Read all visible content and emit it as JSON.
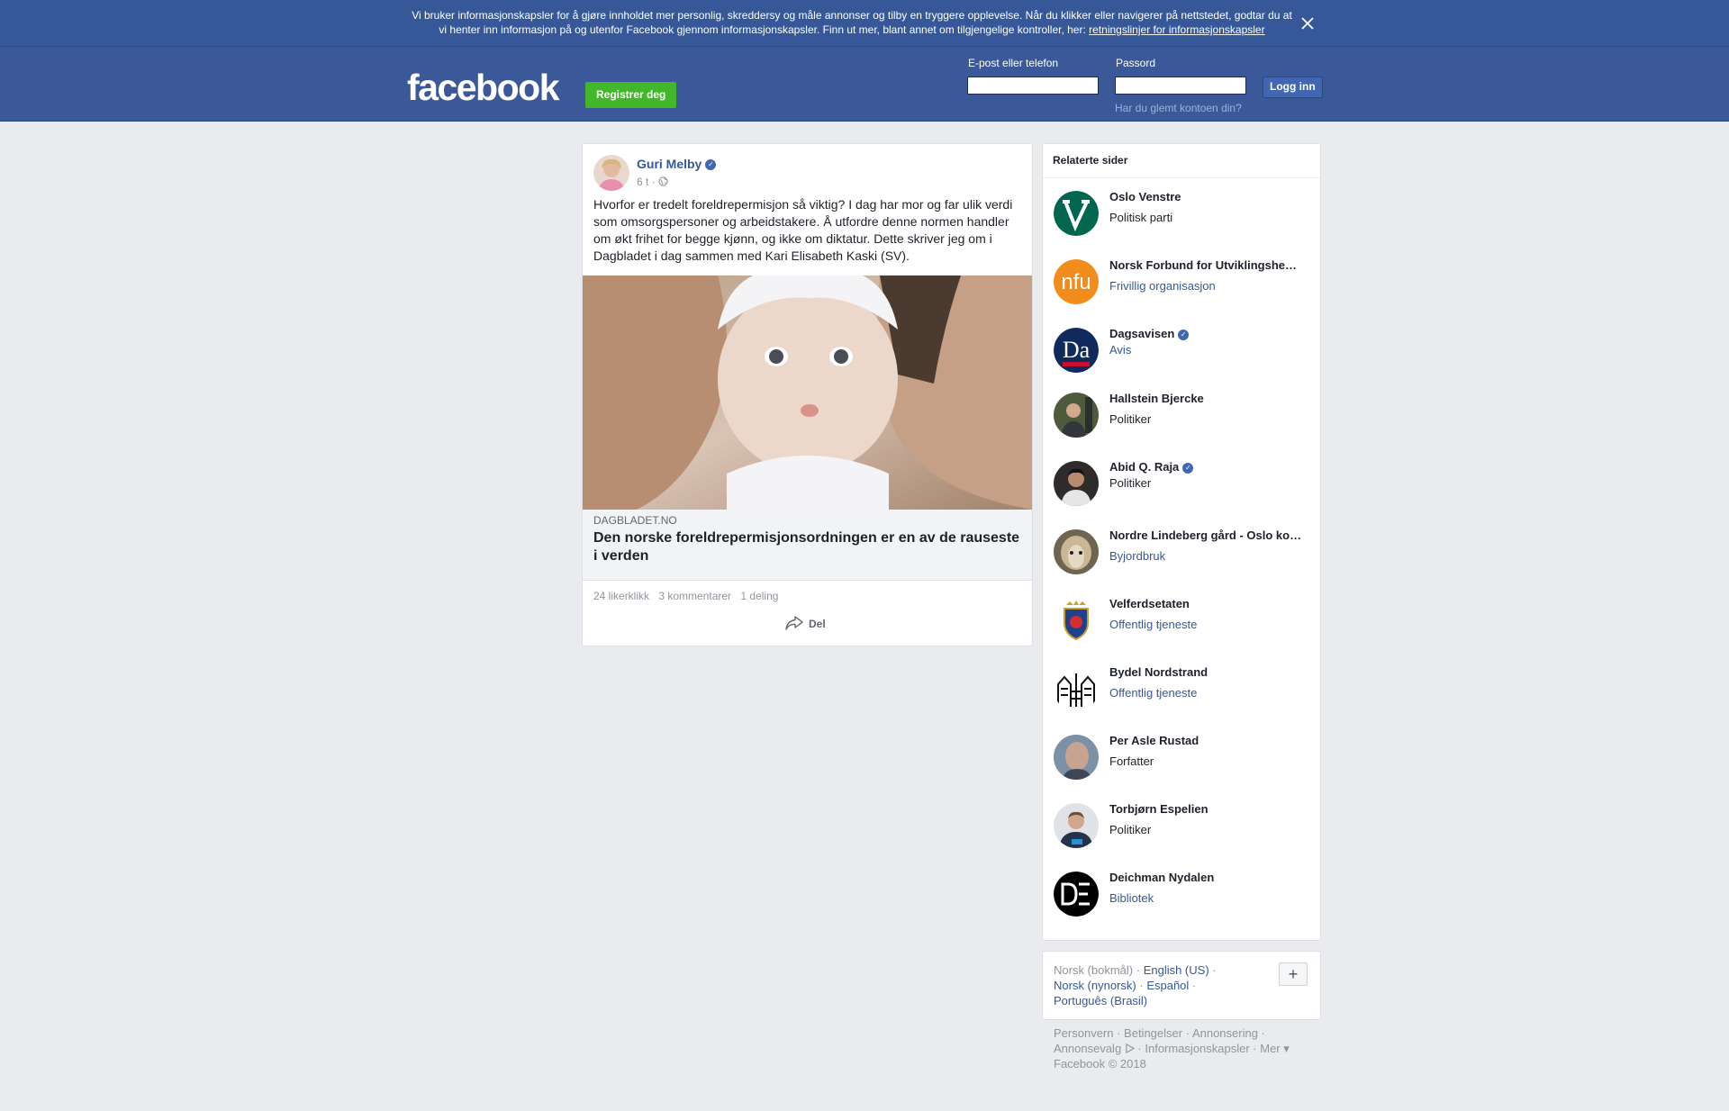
{
  "cookie_banner": {
    "text": "Vi bruker informasjonskapsler for å gjøre innholdet mer personlig, skreddersy og måle annonser og tilby en tryggere opplevelse. Når du klikker eller navigerer på nettstedet, godtar du at vi henter inn informasjon på og utenfor Facebook gjennom informasjonskapsler. Finn ut mer, blant annet om tilgjengelige kontroller, her: ",
    "link": "retningslinjer for informasjonskapsler",
    "close_icon": "close-icon"
  },
  "header": {
    "logo": "facebook",
    "register": "Registrer deg",
    "email_label": "E-post eller telefon",
    "password_label": "Passord",
    "login": "Logg inn",
    "forgot": "Har du glemt kontoen din?"
  },
  "post": {
    "author": "Guri Melby",
    "time": "6 t",
    "text": "Hvorfor er tredelt foreldrepermisjon så viktig? I dag har mor og far ulik verdi som omsorgspersoner og arbeidstakere. Å utfordre denne normen handler om økt frihet for begge kjønn, og ikke om diktatur. Dette skriver jeg om i Dagbladet i dag sammen med Kari Elisabeth Kaski (SV).",
    "link_domain": "DAGBLADET.NO",
    "link_title": "Den norske foreldrepermisjonsordningen er en av de rauseste i verden",
    "likes": "24 likerklikk",
    "comments": "3 kommentarer",
    "shares": "1 deling",
    "share_label": "Del"
  },
  "related": {
    "title": "Relaterte sider",
    "items": [
      {
        "name": "Oslo Venstre",
        "category": "Politisk parti",
        "link": false,
        "verified": false
      },
      {
        "name": "Norsk Forbund for Utviklingshemmede",
        "category": "Frivillig organisasjon",
        "link": true,
        "verified": false
      },
      {
        "name": "Dagsavisen",
        "category": "Avis",
        "link": true,
        "verified": true
      },
      {
        "name": "Hallstein Bjercke",
        "category": "Politiker",
        "link": false,
        "verified": false
      },
      {
        "name": "Abid Q. Raja",
        "category": "Politiker",
        "link": false,
        "verified": true
      },
      {
        "name": "Nordre Lindeberg gård - Oslo kommune",
        "category": "Byjordbruk",
        "link": true,
        "verified": false
      },
      {
        "name": "Velferdsetaten",
        "category": "Offentlig tjeneste",
        "link": true,
        "verified": false
      },
      {
        "name": "Bydel Nordstrand",
        "category": "Offentlig tjeneste",
        "link": true,
        "verified": false
      },
      {
        "name": "Per Asle Rustad",
        "category": "Forfatter",
        "link": false,
        "verified": false
      },
      {
        "name": "Torbjørn Espelien",
        "category": "Politiker",
        "link": false,
        "verified": false
      },
      {
        "name": "Deichman Nydalen",
        "category": "Bibliotek",
        "link": true,
        "verified": false
      }
    ]
  },
  "languages": {
    "current": "Norsk (bokmål)",
    "others": [
      "English (US)",
      "Norsk (nynorsk)",
      "Español",
      "Português (Brasil)"
    ]
  },
  "footer": {
    "links": [
      "Personvern",
      "Betingelser",
      "Annonsering",
      "Annonsevalg",
      "Informasjonskapsler",
      "Mer"
    ],
    "copyright": "Facebook © 2018"
  },
  "colors": {
    "brand": "#3b5998",
    "banner": "#365899",
    "register": "#42b72a",
    "link": "#365899"
  }
}
